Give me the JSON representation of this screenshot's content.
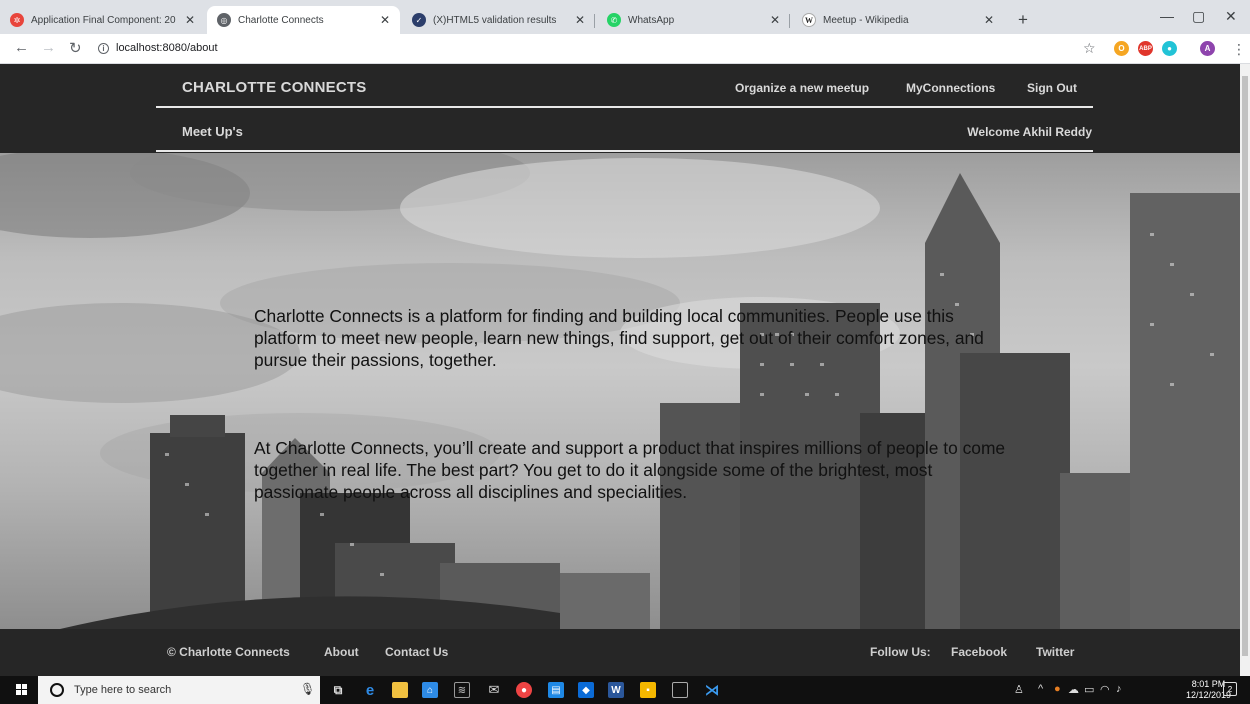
{
  "browser": {
    "tabs": [
      {
        "title": "Application Final Component: 20",
        "active": false
      },
      {
        "title": "Charlotte Connects",
        "active": true
      },
      {
        "title": "(X)HTML5 validation results",
        "active": false
      },
      {
        "title": "WhatsApp",
        "active": false
      },
      {
        "title": "Meetup - Wikipedia",
        "active": false
      }
    ],
    "url": "localhost:8080/about",
    "profile_initial": "A",
    "abp_label": "ABP",
    "wiki_glyph": "W"
  },
  "header": {
    "brand": "CHARLOTTE CONNECTS",
    "nav": {
      "organize": "Organize a new meetup",
      "connections": "MyConnections",
      "signout": "Sign Out"
    },
    "subtitle": "Meet Up's",
    "welcome": "Welcome Akhil Reddy"
  },
  "about": {
    "paragraph1": "Charlotte Connects is a platform for finding and building local communities. People use this platform to meet new people, learn new things, find support, get out of their comfort zones, and pursue their passions, together.",
    "paragraph2": "At Charlotte Connects, you’ll create and support a product that inspires millions of people to come together in real life. The best part? You get to do it alongside some of the brightest, most passionate people across all disciplines and specialities."
  },
  "footer": {
    "copyright": "© Charlotte Connects",
    "about": "About",
    "contact": "Contact Us",
    "follow": "Follow Us:",
    "facebook": "Facebook",
    "twitter": "Twitter"
  },
  "taskbar": {
    "search_placeholder": "Type here to search",
    "time": "8:01 PM",
    "date": "12/12/2019",
    "notifications": "2"
  },
  "colors": {
    "header_bg": "#262626",
    "header_text": "#d9d9d9",
    "accent_profile": "#8e44ad"
  }
}
